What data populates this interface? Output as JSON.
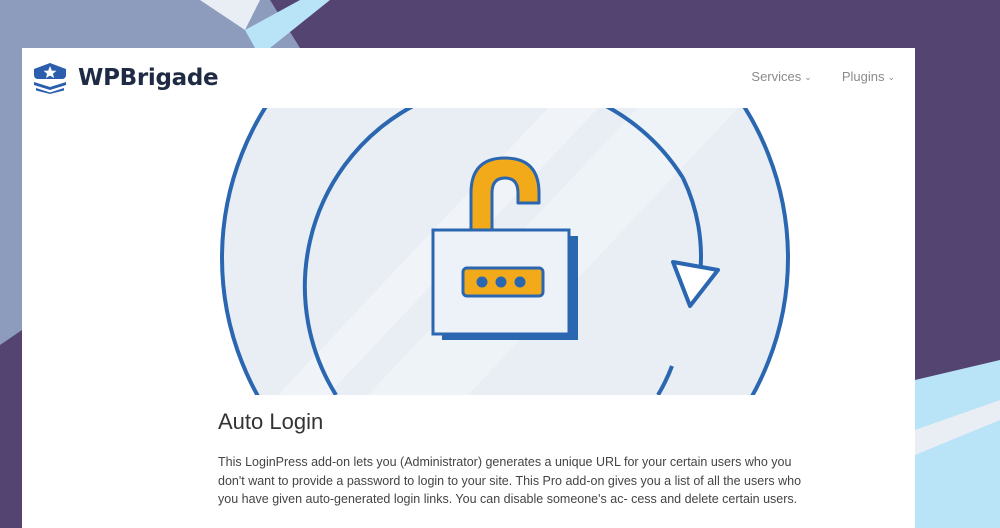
{
  "brand": {
    "name": "WPBrigade"
  },
  "nav": {
    "items": [
      {
        "label": "Services"
      },
      {
        "label": "Plugins"
      }
    ],
    "chevron": "⌄"
  },
  "article": {
    "title": "Auto Login",
    "description": "This LoginPress add-on lets you (Administrator) generates a unique URL for your certain users who you don't want to provide a password to login to your site. This Pro add-on gives you a list of all the users who you have given auto-generated login links. You can disable someone's ac- cess and delete certain users."
  },
  "icons": {
    "logo": "shield-star-icon",
    "hero": "unlocked-padlock-icon",
    "refresh": "circular-arrow-icon"
  },
  "colors": {
    "background": "#544471",
    "brand_dark": "#1f2a44",
    "lock_shackle": "#f2a91a",
    "lock_outline": "#2b67b0",
    "hero_circle": "#e8eef4"
  }
}
